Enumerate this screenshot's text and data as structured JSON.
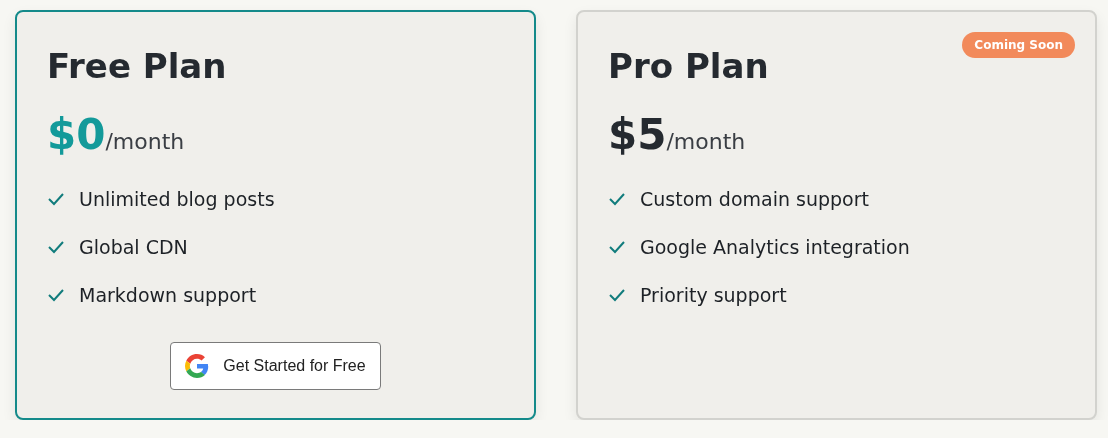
{
  "plans": [
    {
      "title": "Free Plan",
      "highlighted": true,
      "price": "$0",
      "period": "/month",
      "features": [
        "Unlimited blog posts",
        "Global CDN",
        "Markdown support"
      ],
      "button": {
        "label": "Get Started for Free"
      }
    },
    {
      "title": "Pro Plan",
      "highlighted": false,
      "badge": "Coming Soon",
      "price": "$5",
      "period": "/month",
      "features": [
        "Custom domain support",
        "Google Analytics integration",
        "Priority support"
      ]
    }
  ]
}
